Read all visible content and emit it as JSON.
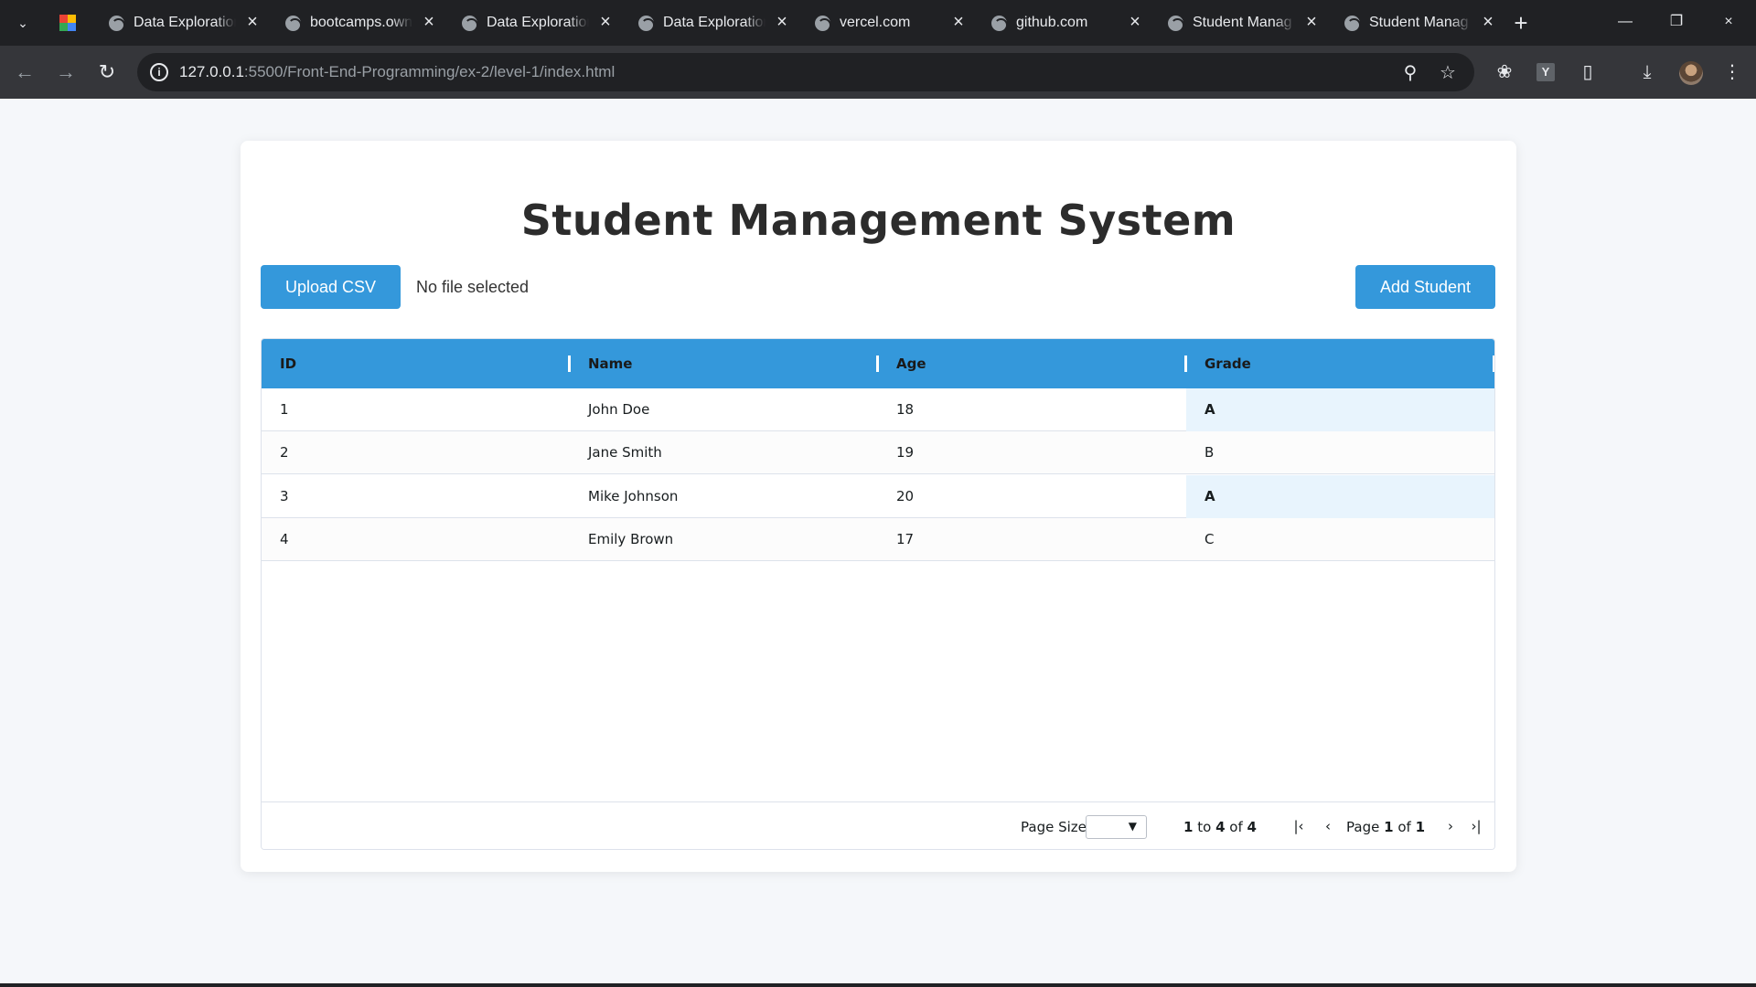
{
  "browser": {
    "tabs": [
      {
        "title": "Data Exploration"
      },
      {
        "title": "bootcamps.own"
      },
      {
        "title": "Data Exploration"
      },
      {
        "title": "Data Exploration"
      },
      {
        "title": "vercel.com"
      },
      {
        "title": "github.com"
      },
      {
        "title": "Student Manag"
      },
      {
        "title": "Student Manag"
      }
    ],
    "url_host": "127.0.0.1",
    "url_path": ":5500/Front-End-Programming/ex-2/level-1/index.html",
    "extension_label": "Y",
    "icons": {
      "tab_search": "chevron-down-icon",
      "new_tab": "plus-icon",
      "back": "arrow-left-icon",
      "forward": "arrow-right-icon",
      "reload": "reload-icon",
      "zoom": "magnifier-icon",
      "bookmark": "star-icon",
      "extensions": "puzzle-icon",
      "download": "download-icon",
      "menu": "kebab-menu-icon"
    }
  },
  "page": {
    "title": "Student Management System",
    "upload_button": "Upload CSV",
    "file_status": "No file selected",
    "add_button": "Add Student",
    "accent_color": "#3498db"
  },
  "table": {
    "columns": [
      "ID",
      "Name",
      "Age",
      "Grade"
    ],
    "rows": [
      {
        "id": "1",
        "name": "John Doe",
        "age": "18",
        "grade": "A"
      },
      {
        "id": "2",
        "name": "Jane Smith",
        "age": "19",
        "grade": "B"
      },
      {
        "id": "3",
        "name": "Mike Johnson",
        "age": "20",
        "grade": "A"
      },
      {
        "id": "4",
        "name": "Emily Brown",
        "age": "17",
        "grade": "C"
      }
    ]
  },
  "pagination": {
    "page_size_label": "Page Size:",
    "page_size_value": "",
    "range_from": "1",
    "range_to_label": "to",
    "range_to": "4",
    "range_of_label": "of",
    "range_total": "4",
    "page_label": "Page",
    "page_current": "1",
    "page_of_label": "of",
    "page_total": "1"
  }
}
